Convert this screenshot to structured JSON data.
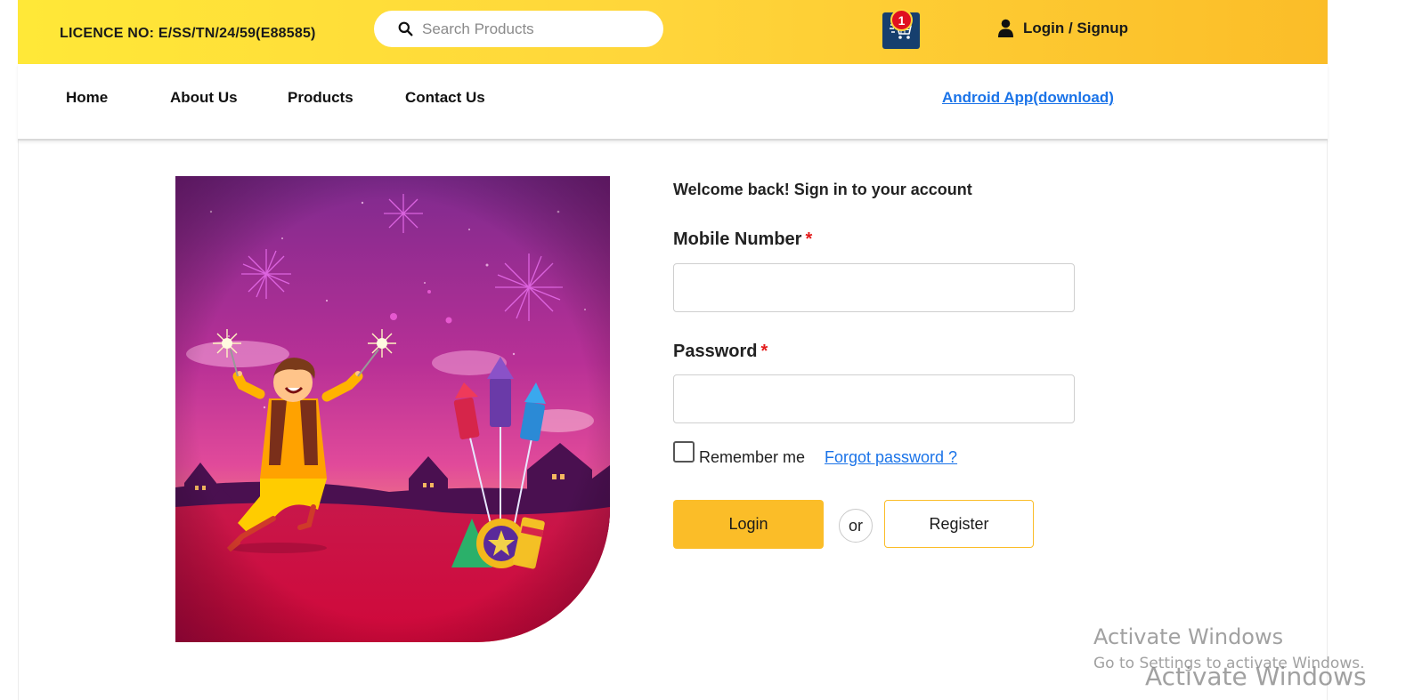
{
  "header": {
    "licence": "LICENCE NO: E/SS/TN/24/59(E88585)",
    "search_placeholder": "Search Products",
    "cart_count": "1",
    "login_label": "Login / Signup"
  },
  "nav": {
    "items": [
      {
        "label": "Home"
      },
      {
        "label": "About Us"
      },
      {
        "label": "Products"
      },
      {
        "label": "Contact Us"
      }
    ],
    "android_link": "Android App(download)"
  },
  "login_form": {
    "welcome": "Welcome back! Sign in to your account",
    "mobile_label": "Mobile Number",
    "password_label": "Password",
    "required_mark": "*",
    "remember_label": "Remember me",
    "forgot_link": "Forgot password ?",
    "login_button": "Login",
    "or_text": "or",
    "register_button": "Register"
  },
  "watermark": {
    "title": "Activate Windows",
    "subtitle": "Go to Settings to activate Windows.",
    "title_overlap": "Activate Windows"
  },
  "colors": {
    "topbar_start": "#ffe838",
    "topbar_end": "#fbbd28",
    "accent": "#fbbd28",
    "link": "#1a73e8",
    "cart_bg": "#163f6e",
    "badge": "#e01020",
    "required": "#e31b1b"
  },
  "icons": {
    "search": "search-icon",
    "cart": "cart-icon",
    "user": "user-icon"
  }
}
